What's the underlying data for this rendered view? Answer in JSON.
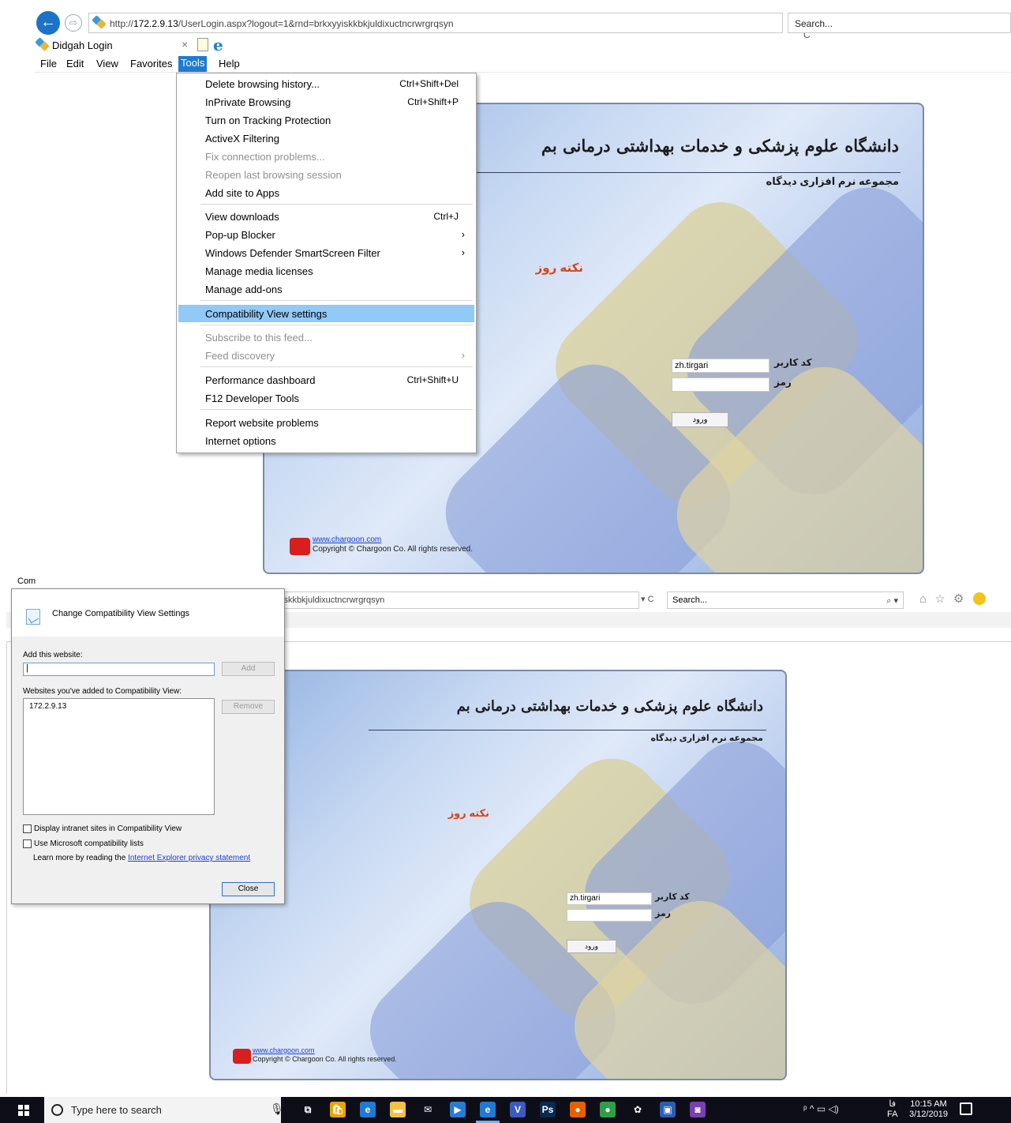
{
  "browser1": {
    "url_prefix": "http://",
    "url_host": "172.2.9.13",
    "url_path": "/UserLogin.aspx?logout=1&rnd=brkxyyiskkbkjuldixuctncrwrgrqsyn",
    "refresh_glyph": "▾ C",
    "search_placeholder": "Search...",
    "tab_title": "Didgah Login",
    "tab_close": "×",
    "menu": [
      "File",
      "Edit",
      "View",
      "Favorites",
      "Tools",
      "Help"
    ]
  },
  "tools_menu": {
    "items": [
      {
        "label": "Delete browsing history...",
        "shortcut": "Ctrl+Shift+Del"
      },
      {
        "label": "InPrivate Browsing",
        "shortcut": "Ctrl+Shift+P"
      },
      {
        "label": "Turn on Tracking Protection",
        "shortcut": ""
      },
      {
        "label": "ActiveX Filtering",
        "shortcut": ""
      },
      {
        "label": "Fix connection problems...",
        "shortcut": ""
      },
      {
        "label": "Reopen last browsing session",
        "shortcut": ""
      },
      {
        "label": "Add site to Apps",
        "shortcut": ""
      },
      {
        "label": "View downloads",
        "shortcut": "Ctrl+J"
      },
      {
        "label": "Pop-up Blocker",
        "shortcut": ""
      },
      {
        "label": "Windows Defender SmartScreen Filter",
        "shortcut": ""
      },
      {
        "label": "Manage media licenses",
        "shortcut": ""
      },
      {
        "label": "Manage add-ons",
        "shortcut": ""
      },
      {
        "label": "Compatibility View settings",
        "shortcut": ""
      },
      {
        "label": "Subscribe to this feed...",
        "shortcut": ""
      },
      {
        "label": "Feed discovery",
        "shortcut": ""
      },
      {
        "label": "Performance dashboard",
        "shortcut": "Ctrl+Shift+U"
      },
      {
        "label": "F12 Developer Tools",
        "shortcut": ""
      },
      {
        "label": "Report website problems",
        "shortcut": ""
      },
      {
        "label": "Internet options",
        "shortcut": ""
      }
    ],
    "submenu_arrow": "›"
  },
  "login": {
    "title": "دانشگاه علوم پزشکی و خدمات بهداشتی درمانی بم",
    "subtitle": "مجموعه نرم افزاری دیدگاه",
    "tip_of_day": "نکته روز",
    "username_label": "کد کاربر",
    "username_value": "zh.tirgari",
    "password_label": "رمز",
    "login_button": "ورود",
    "site_link": "www.chargoon.com",
    "copyright": "Copyright © Chargoon Co. All rights reserved."
  },
  "browser2": {
    "url_fragment": "iskkbkjuldixuctncrwrgrqsyn",
    "refresh_glyph": "▾ C",
    "search_placeholder": "Search...",
    "search_icon": "⌕ ▾",
    "toolbar_icons": "⌂ ☆ ⚙"
  },
  "compat_dialog": {
    "window_title_stub": "Com",
    "heading": "Change Compatibility View Settings",
    "add_label": "Add this website:",
    "add_value": "|",
    "add_button": "Add",
    "list_label": "Websites you've added to Compatibility View:",
    "sites": [
      "172.2.9.13"
    ],
    "remove_button": "Remove",
    "check_intranet": "Display intranet sites in Compatibility View",
    "check_ms_lists": "Use Microsoft compatibility lists",
    "learn_more": "Learn more by reading the ",
    "privacy_link": "Internet Explorer privacy statement",
    "close_button": "Close"
  },
  "taskbar": {
    "search_placeholder": "Type here to search",
    "mic_glyph": "🎙",
    "tray_icons": "ᵖ ^ ▭ ◁)",
    "lang_top": "فا",
    "lang_bottom": "FA",
    "time": "10:15 AM",
    "date": "3/12/2019",
    "apps": [
      {
        "name": "task-view",
        "color": "#0e0e18",
        "glyph": "⧉"
      },
      {
        "name": "store",
        "color": "#e7a500",
        "glyph": "🛍"
      },
      {
        "name": "edge",
        "color": "#1f7bd1",
        "glyph": "e"
      },
      {
        "name": "file-explorer",
        "color": "#f0c246",
        "glyph": "▬"
      },
      {
        "name": "mail",
        "color": "#0e0e18",
        "glyph": "✉"
      },
      {
        "name": "media",
        "color": "#2a7bd4",
        "glyph": "▶"
      },
      {
        "name": "internet-explorer",
        "color": "#1f7bd1",
        "glyph": "e"
      },
      {
        "name": "visio",
        "color": "#3b5bbd",
        "glyph": "V"
      },
      {
        "name": "photoshop",
        "color": "#0b2a52",
        "glyph": "Ps"
      },
      {
        "name": "firefox",
        "color": "#e66000",
        "glyph": "●"
      },
      {
        "name": "chrome",
        "color": "#2e9e47",
        "glyph": "●"
      },
      {
        "name": "paint",
        "color": "#0e0e18",
        "glyph": "✿"
      },
      {
        "name": "remote-desktop",
        "color": "#2b5fb4",
        "glyph": "▣"
      },
      {
        "name": "app-purple",
        "color": "#7a3fb0",
        "glyph": "◙"
      }
    ]
  },
  "colors": {
    "accent": "#1f7bd1",
    "menu_highlight": "#91c9f7",
    "tip_color": "#d9441a",
    "link_color": "#1a3fd0"
  }
}
